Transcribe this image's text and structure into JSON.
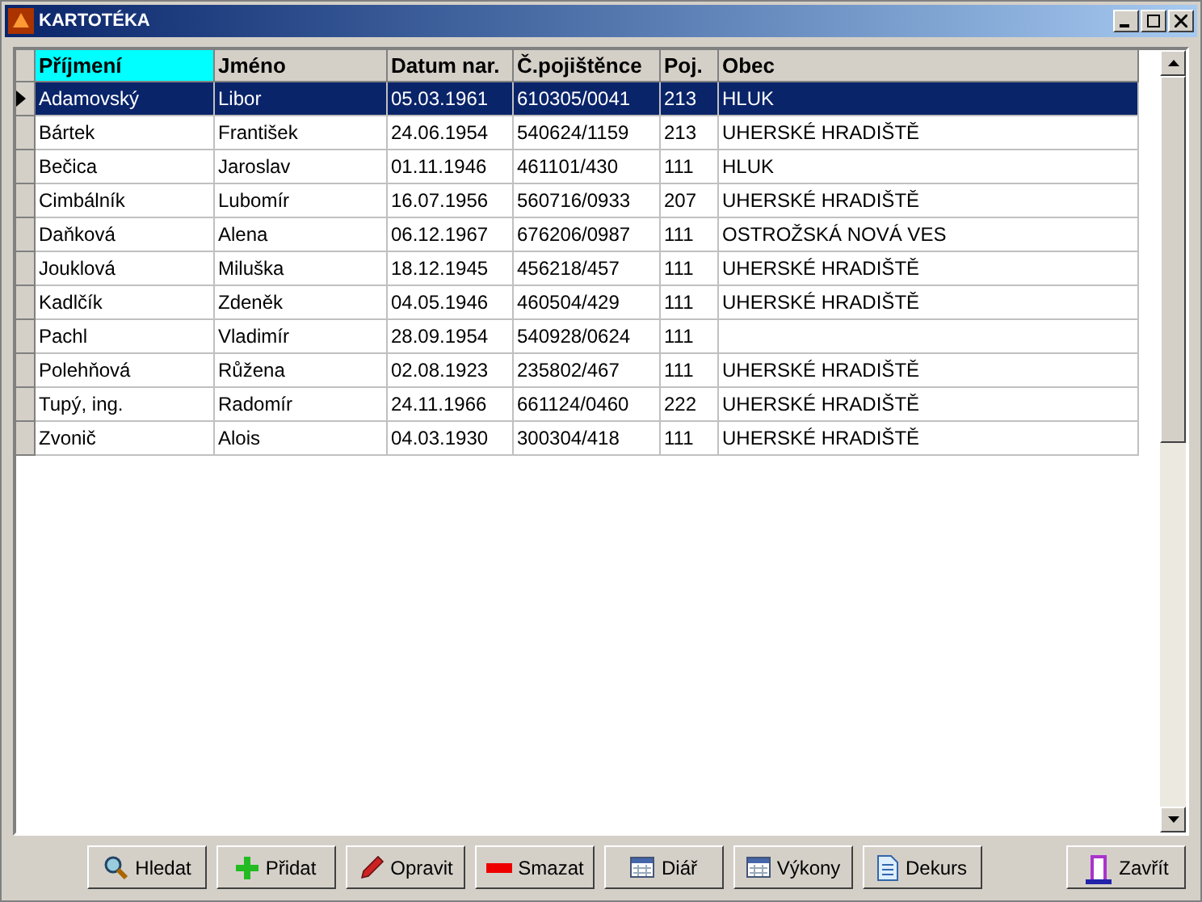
{
  "window": {
    "title": "KARTOTÉKA"
  },
  "table": {
    "columns": [
      {
        "label": "Příjmení",
        "selected": true
      },
      {
        "label": "Jméno",
        "selected": false
      },
      {
        "label": "Datum nar.",
        "selected": false
      },
      {
        "label": "Č.pojištěnce",
        "selected": false
      },
      {
        "label": "Poj.",
        "selected": false
      },
      {
        "label": "Obec",
        "selected": false
      }
    ],
    "rows": [
      {
        "selected": true,
        "cells": [
          "Adamovský",
          "Libor",
          "05.03.1961",
          "610305/0041",
          "213",
          "HLUK"
        ]
      },
      {
        "selected": false,
        "cells": [
          "Bártek",
          "František",
          "24.06.1954",
          "540624/1159",
          "213",
          "UHERSKÉ HRADIŠTĚ"
        ]
      },
      {
        "selected": false,
        "cells": [
          "Bečica",
          "Jaroslav",
          "01.11.1946",
          "461101/430",
          "111",
          "HLUK"
        ]
      },
      {
        "selected": false,
        "cells": [
          "Cimbálník",
          "Lubomír",
          "16.07.1956",
          "560716/0933",
          "207",
          "UHERSKÉ HRADIŠTĚ"
        ]
      },
      {
        "selected": false,
        "cells": [
          "Daňková",
          "Alena",
          "06.12.1967",
          "676206/0987",
          "111",
          "OSTROŽSKÁ NOVÁ VES"
        ]
      },
      {
        "selected": false,
        "cells": [
          "Jouklová",
          "Miluška",
          "18.12.1945",
          "456218/457",
          "111",
          "UHERSKÉ HRADIŠTĚ"
        ]
      },
      {
        "selected": false,
        "cells": [
          "Kadlčík",
          "Zdeněk",
          "04.05.1946",
          "460504/429",
          "111",
          "UHERSKÉ HRADIŠTĚ"
        ]
      },
      {
        "selected": false,
        "cells": [
          "Pachl",
          "Vladimír",
          "28.09.1954",
          "540928/0624",
          "111",
          ""
        ]
      },
      {
        "selected": false,
        "cells": [
          "Polehňová",
          "Růžena",
          "02.08.1923",
          "235802/467",
          "111",
          "UHERSKÉ HRADIŠTĚ"
        ]
      },
      {
        "selected": false,
        "cells": [
          "Tupý, ing.",
          "Radomír",
          "24.11.1966",
          "661124/0460",
          "222",
          "UHERSKÉ HRADIŠTĚ"
        ]
      },
      {
        "selected": false,
        "cells": [
          "Zvonič",
          "Alois",
          "04.03.1930",
          "300304/418",
          "111",
          "UHERSKÉ HRADIŠTĚ"
        ]
      }
    ]
  },
  "buttons": [
    {
      "kind": "search",
      "label": "Hledat"
    },
    {
      "kind": "add",
      "label": "Přidat"
    },
    {
      "kind": "edit",
      "label": "Opravit"
    },
    {
      "kind": "delete",
      "label": "Smazat"
    },
    {
      "kind": "calendar",
      "label": "Diář"
    },
    {
      "kind": "calendar",
      "label": "Výkony"
    },
    {
      "kind": "document",
      "label": "Dekurs"
    },
    {
      "kind": "exit",
      "label": "Zavřít"
    }
  ]
}
